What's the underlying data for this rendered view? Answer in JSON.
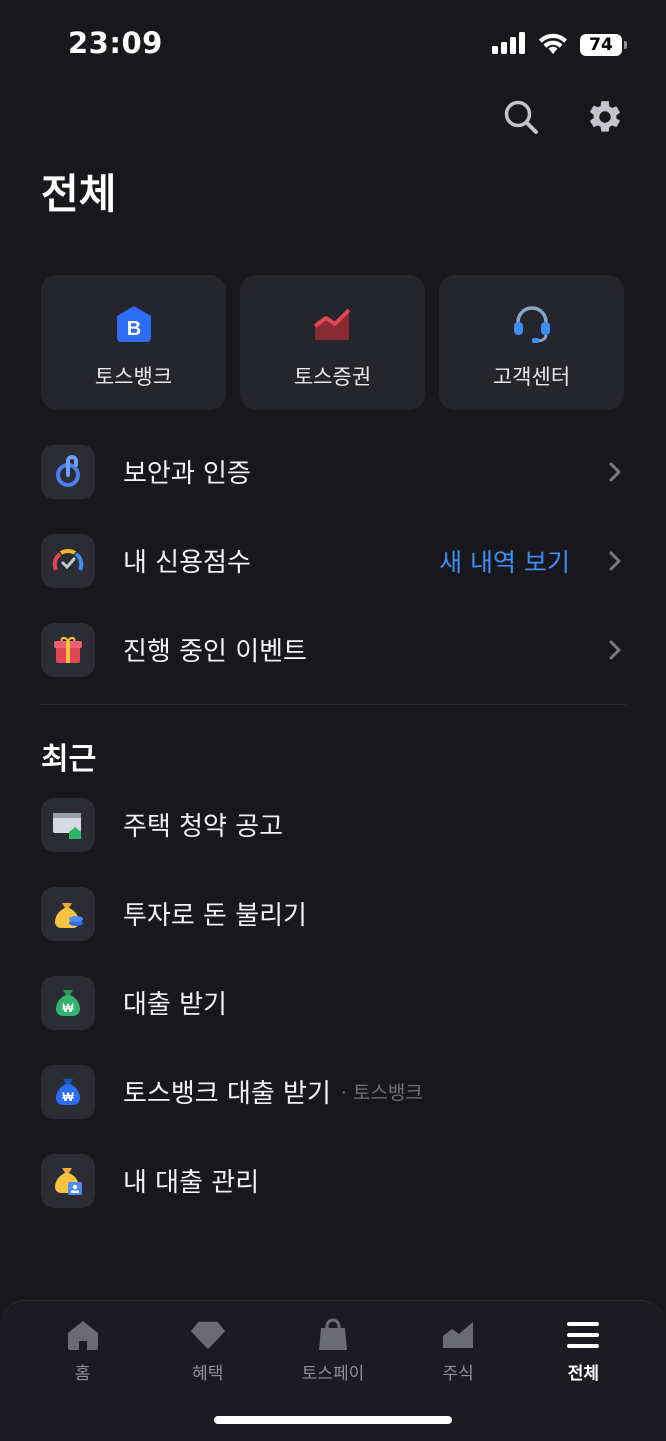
{
  "status_bar": {
    "time": "23:09",
    "battery": "74"
  },
  "header": {
    "title": "전체",
    "search_icon": "search-icon",
    "settings_icon": "gear-icon"
  },
  "quick_cards": [
    {
      "label": "토스뱅크",
      "icon": "toss-bank-icon",
      "color": "#2d6cf5"
    },
    {
      "label": "토스증권",
      "icon": "stock-chart-icon",
      "color": "#e04654"
    },
    {
      "label": "고객센터",
      "icon": "headset-icon",
      "color": "#3f8cf5"
    }
  ],
  "menu": [
    {
      "label": "보안과 인증",
      "icon": "security-icon"
    },
    {
      "label": "내 신용점수",
      "icon": "credit-gauge-icon",
      "link": "새 내역 보기"
    },
    {
      "label": "진행 중인 이벤트",
      "icon": "gift-icon"
    }
  ],
  "recent": {
    "title": "최근",
    "items": [
      {
        "label": "주택 청약 공고",
        "icon": "house-notice-icon"
      },
      {
        "label": "투자로 돈 불리기",
        "icon": "money-bag-coins-icon"
      },
      {
        "label": "대출 받기",
        "icon": "won-bag-green-icon"
      },
      {
        "label": "토스뱅크 대출 받기",
        "sub": "· 토스뱅크",
        "icon": "won-bag-blue-icon"
      },
      {
        "label": "내 대출 관리",
        "icon": "money-bag-card-icon"
      }
    ]
  },
  "bottom_nav": [
    {
      "label": "홈",
      "icon": "home-icon"
    },
    {
      "label": "혜택",
      "icon": "diamond-icon"
    },
    {
      "label": "토스페이",
      "icon": "shopping-bag-icon"
    },
    {
      "label": "주식",
      "icon": "stock-icon"
    },
    {
      "label": "전체",
      "icon": "menu-icon",
      "active": true
    }
  ],
  "colors": {
    "background": "#17171c",
    "card": "#25252c",
    "accent": "#3f8cf5"
  }
}
